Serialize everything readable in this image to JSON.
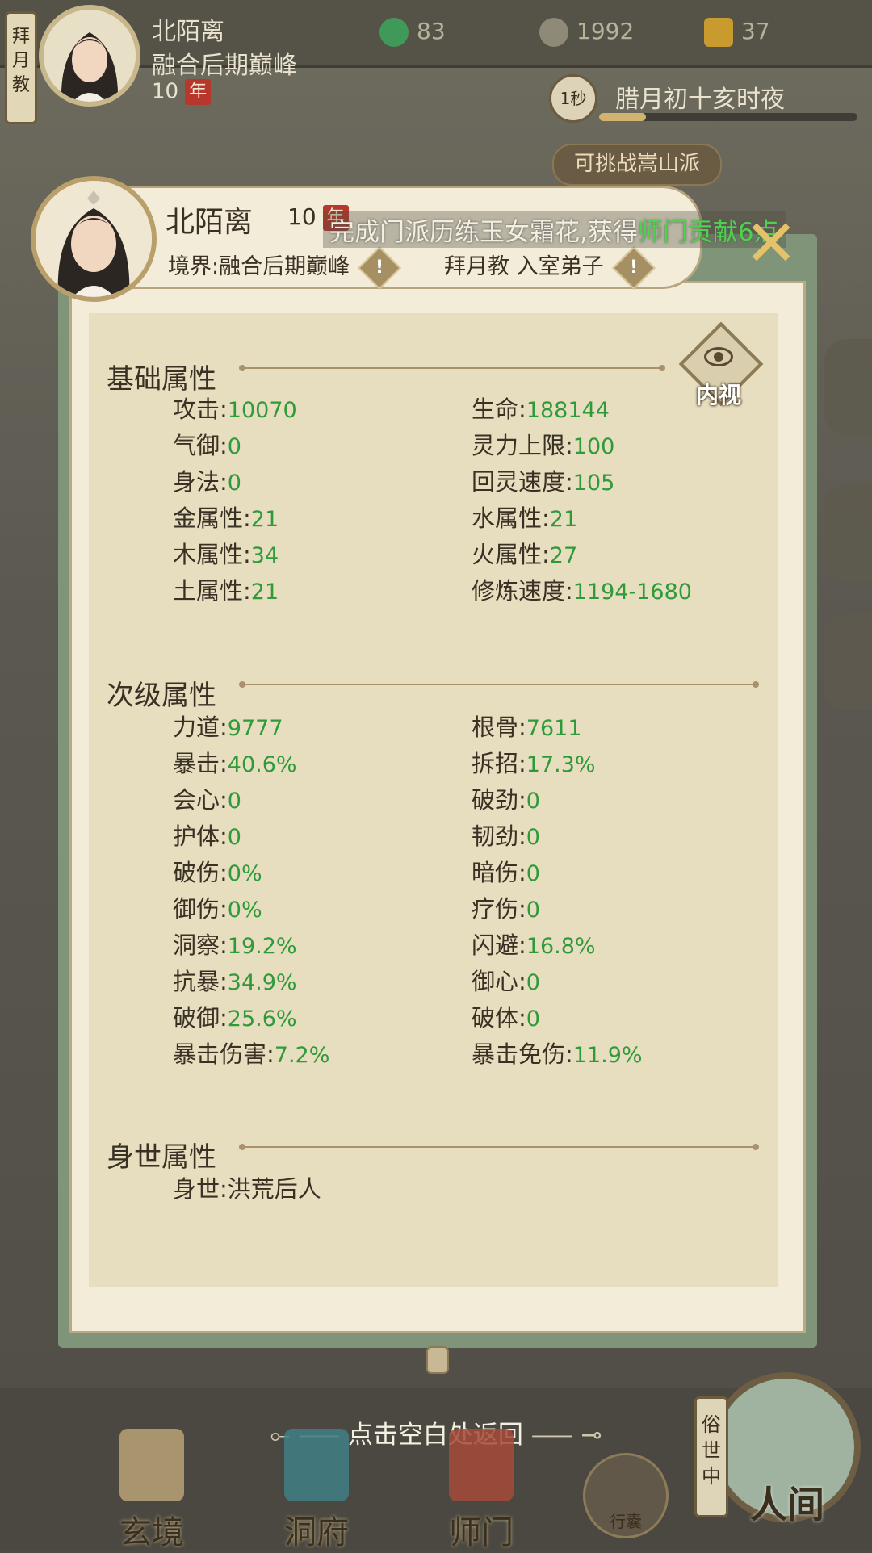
{
  "topbar": {
    "sect_label": "拜月教",
    "player_name": "北陌离",
    "realm": "融合后期巅峰",
    "age": "10",
    "age_unit": "年",
    "resources": [
      {
        "icon": "jade-icon",
        "value": "83",
        "color": "#3f9a59"
      },
      {
        "icon": "coin-icon",
        "value": "1992",
        "color": "#8f8a78"
      },
      {
        "icon": "merit-icon",
        "value": "37",
        "color": "#c99a2e"
      }
    ],
    "time_btn": "1秒",
    "time_text": "腊月初十亥时夜",
    "time_progress": 0.18,
    "challenge": "可挑战嵩山派"
  },
  "header": {
    "name": "北陌离",
    "age": "10",
    "age_unit": "年",
    "realm_label": "境界:融合后期巅峰",
    "sect_label": "拜月教 入室弟子",
    "warn_icon": "!"
  },
  "ticker": {
    "prefix": "完成门派历练玉女霜花,获得",
    "highlight": "师门贡献6点"
  },
  "eye_button": "内视",
  "sections": {
    "basic": {
      "title": "基础属性",
      "stats": [
        {
          "label": "攻击",
          "value": "10070"
        },
        {
          "label": "生命",
          "value": "188144"
        },
        {
          "label": "气御",
          "value": "0"
        },
        {
          "label": "灵力上限",
          "value": "100"
        },
        {
          "label": "身法",
          "value": "0"
        },
        {
          "label": "回灵速度",
          "value": "105"
        },
        {
          "label": "金属性",
          "value": "21"
        },
        {
          "label": "水属性",
          "value": "21"
        },
        {
          "label": "木属性",
          "value": "34"
        },
        {
          "label": "火属性",
          "value": "27"
        },
        {
          "label": "土属性",
          "value": "21"
        },
        {
          "label": "修炼速度",
          "value": "1194-1680"
        }
      ]
    },
    "secondary": {
      "title": "次级属性",
      "stats": [
        {
          "label": "力道",
          "value": "9777"
        },
        {
          "label": "根骨",
          "value": "7611"
        },
        {
          "label": "暴击",
          "value": "40.6%"
        },
        {
          "label": "拆招",
          "value": "17.3%"
        },
        {
          "label": "会心",
          "value": "0"
        },
        {
          "label": "破劲",
          "value": "0"
        },
        {
          "label": "护体",
          "value": "0"
        },
        {
          "label": "韧劲",
          "value": "0"
        },
        {
          "label": "破伤",
          "value": "0%"
        },
        {
          "label": "暗伤",
          "value": "0"
        },
        {
          "label": "御伤",
          "value": "0%"
        },
        {
          "label": "疗伤",
          "value": "0"
        },
        {
          "label": "洞察",
          "value": "19.2%"
        },
        {
          "label": "闪避",
          "value": "16.8%"
        },
        {
          "label": "抗暴",
          "value": "34.9%"
        },
        {
          "label": "御心",
          "value": "0"
        },
        {
          "label": "破御",
          "value": "25.6%"
        },
        {
          "label": "破体",
          "value": "0"
        },
        {
          "label": "暴击伤害",
          "value": "7.2%"
        },
        {
          "label": "暴击免伤",
          "value": "11.9%"
        }
      ]
    },
    "origin": {
      "title": "身世属性",
      "stats": [
        {
          "label": "身世",
          "value": "洪荒后人"
        }
      ]
    }
  },
  "back_hint": "点击空白处返回",
  "nav": [
    {
      "label": "玄境",
      "icon": "scroll-icon",
      "color": "#b9a377"
    },
    {
      "label": "洞府",
      "icon": "cave-icon",
      "color": "#3f7f86"
    },
    {
      "label": "师门",
      "icon": "sect-gate-icon",
      "color": "#a44a3a"
    }
  ],
  "bag_label": "行囊",
  "world": {
    "tag": "俗世中",
    "label": "人间"
  },
  "colors": {
    "stat_value": "#2f9a3a",
    "ticker_highlight": "#4fd14e",
    "panel_frame": "#7f9478"
  }
}
